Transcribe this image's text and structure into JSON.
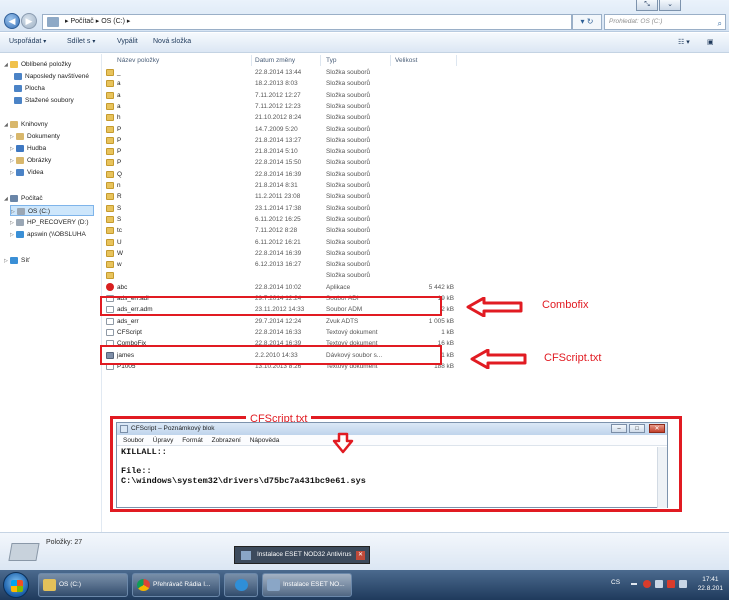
{
  "address": {
    "path": "▸ Počítač ▸ OS (C:) ▸",
    "search_placeholder": "Prohledat: OS (C:)"
  },
  "toolbar": {
    "organize": "Uspořádat",
    "share": "Sdílet s",
    "burn": "Vypálit",
    "new_folder": "Nová složka"
  },
  "sidebar": {
    "favorites": "Oblíbené položky",
    "recent": "Naposledy navštívené",
    "desktop": "Plocha",
    "downloads": "Stažené soubory",
    "libraries": "Knihovny",
    "documents": "Dokumenty",
    "music": "Hudba",
    "pictures": "Obrázky",
    "videos": "Videa",
    "computer": "Počítač",
    "drive_c": "OS (C:)",
    "drive_d": "HP_RECOVERY (D:)",
    "network_drive": "apswin (\\\\OBSLUHA",
    "network": "Síť"
  },
  "columns": {
    "name": "Název položky",
    "date": "Datum změny",
    "type": "Typ",
    "size": "Velikost"
  },
  "files": [
    {
      "icon": "folder",
      "name": "_",
      "date": "22.8.2014 13:44",
      "type": "Složka souborů",
      "size": ""
    },
    {
      "icon": "folder",
      "name": "a",
      "date": "18.2.2013 8:03",
      "type": "Složka souborů",
      "size": ""
    },
    {
      "icon": "folder",
      "name": "a",
      "date": "7.11.2012 12:27",
      "type": "Složka souborů",
      "size": ""
    },
    {
      "icon": "folder",
      "name": "a",
      "date": "7.11.2012 12:23",
      "type": "Složka souborů",
      "size": ""
    },
    {
      "icon": "folder",
      "name": "h",
      "date": "21.10.2012 8:24",
      "type": "Složka souborů",
      "size": ""
    },
    {
      "icon": "folder",
      "name": "P",
      "date": "14.7.2009 5:20",
      "type": "Složka souborů",
      "size": ""
    },
    {
      "icon": "folder",
      "name": "P",
      "date": "21.8.2014 13:27",
      "type": "Složka souborů",
      "size": ""
    },
    {
      "icon": "folder",
      "name": "P",
      "date": "21.8.2014 5:10",
      "type": "Složka souborů",
      "size": ""
    },
    {
      "icon": "folder",
      "name": "P",
      "date": "22.8.2014 15:50",
      "type": "Složka souborů",
      "size": ""
    },
    {
      "icon": "folder",
      "name": "Q",
      "date": "22.8.2014 16:39",
      "type": "Složka souborů",
      "size": ""
    },
    {
      "icon": "folder",
      "name": "n",
      "date": "21.8.2014 8:31",
      "type": "Složka souborů",
      "size": ""
    },
    {
      "icon": "folder",
      "name": "R",
      "date": "11.2.2011 23:08",
      "type": "Složka souborů",
      "size": ""
    },
    {
      "icon": "folder",
      "name": "S",
      "date": "23.1.2014 17:38",
      "type": "Složka souborů",
      "size": ""
    },
    {
      "icon": "folder",
      "name": "S",
      "date": "6.11.2012 16:25",
      "type": "Složka souborů",
      "size": ""
    },
    {
      "icon": "folder",
      "name": "tc",
      "date": "7.11.2012 8:28",
      "type": "Složka souborů",
      "size": ""
    },
    {
      "icon": "folder",
      "name": "U",
      "date": "6.11.2012 16:21",
      "type": "Složka souborů",
      "size": ""
    },
    {
      "icon": "folder",
      "name": "W",
      "date": "22.8.2014 16:39",
      "type": "Složka souborů",
      "size": ""
    },
    {
      "icon": "folder",
      "name": "w",
      "date": "6.12.2013 16:27",
      "type": "Složka souborů",
      "size": ""
    },
    {
      "icon": "folder",
      "name": "",
      "date": "",
      "type": "Složka souborů",
      "size": ""
    },
    {
      "icon": "app",
      "name": "abc",
      "date": "22.8.2014 10:02",
      "type": "Aplikace",
      "size": "5 442 kB"
    },
    {
      "icon": "file",
      "name": "ads_err.adi",
      "date": "29.7.2014 12:24",
      "type": "Soubor ADI",
      "size": "19 kB"
    },
    {
      "icon": "file",
      "name": "ads_err.adm",
      "date": "23.11.2012 14:33",
      "type": "Soubor ADM",
      "size": "2 kB"
    },
    {
      "icon": "file",
      "name": "ads_err",
      "date": "29.7.2014 12:24",
      "type": "Zvuk ADTS",
      "size": "1 005 kB"
    },
    {
      "icon": "file",
      "name": "CFScript",
      "date": "22.8.2014 16:33",
      "type": "Textový dokument",
      "size": "1 kB"
    },
    {
      "icon": "file",
      "name": "ComboFix",
      "date": "22.8.2014 16:39",
      "type": "Textový dokument",
      "size": "16 kB"
    },
    {
      "icon": "bat",
      "name": "james",
      "date": "2.2.2010 14:33",
      "type": "Dávkový soubor s...",
      "size": "1 kB"
    },
    {
      "icon": "file",
      "name": "P1005",
      "date": "13.10.2013 8:26",
      "type": "Textový dokument",
      "size": "188 kB"
    }
  ],
  "annotations": {
    "combofix": "Combofix",
    "cfscript": "CFScript.txt",
    "cfscript_top": "CFScript.txt"
  },
  "notepad": {
    "title": "CFScript – Poznámkový blok",
    "menu": [
      "Soubor",
      "Úpravy",
      "Formát",
      "Zobrazení",
      "Nápověda"
    ],
    "lines": [
      "KILLALL::",
      "",
      "File::",
      "C:\\windows\\system32\\drivers\\d75bc7a431bc9e61.sys"
    ]
  },
  "details": {
    "count": "Položky: 27"
  },
  "taskbar": {
    "popup": "Instalace ESET NOD32 Antivirus",
    "items": [
      "OS (C:)",
      "Přehrávač Rádia I...",
      "",
      "Instalace ESET NO..."
    ],
    "lang": "CS",
    "time": "17:41",
    "date": "22.8.201"
  },
  "colors": {
    "accent_red": "#e11b22",
    "taskbar": "#1f3a5c"
  }
}
